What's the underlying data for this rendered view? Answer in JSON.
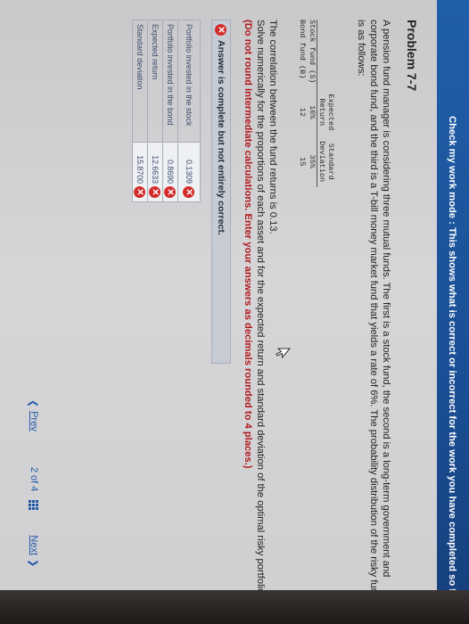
{
  "banner": {
    "text": "Check my work mode : This shows what is correct or incorrect for the work you have completed so far. It does"
  },
  "problem": {
    "title": "Problem 7-7",
    "intro": "A pension fund manager is considering three mutual funds. The first is a stock fund, the second is a long-term government and corporate bond fund, and the third is a T-bill money market fund that yields a rate of 6%. The probability distribution of the risky funds is as follows:",
    "table": {
      "headers": [
        "",
        "Expected Return",
        "Standard Deviation"
      ],
      "header_lines": [
        [
          "Expected",
          "Return"
        ],
        [
          "Standard",
          "Deviation"
        ]
      ],
      "rows": [
        {
          "label": "Stock fund (S)",
          "expected": "16%",
          "stdev": "35%"
        },
        {
          "label": "Bond fund (B)",
          "expected": "12",
          "stdev": "15"
        }
      ]
    },
    "correlation": "The correlation between the fund returns is 0.13.",
    "question": "Solve numerically for the proportions of each asset and for the expected return and standard deviation of the optimal risky portfolio.",
    "instruction": "(Do not round intermediate calculations. Enter your answers as decimals rounded to 4 places.)"
  },
  "answer": {
    "status": "Answer is complete but not entirely correct.",
    "rows": [
      {
        "label": "Portfolio invested in the stock",
        "value": "0.1309"
      },
      {
        "label": "Portfolio invested in the bond",
        "value": "0.8690"
      },
      {
        "label": "Expected return",
        "value": "12.6633"
      },
      {
        "label": "Standard deviation",
        "value": "15.8700"
      }
    ]
  },
  "pager": {
    "prev": "Prev",
    "current": "2",
    "of": "of",
    "total": "4",
    "next": "Next"
  },
  "colors": {
    "banner": "#1f5fa8",
    "incorrect": "#d42b2b",
    "instruction": "#b0191c",
    "link": "#1f57a8"
  },
  "icons": [
    "x-circle-icon",
    "chevron-left-icon",
    "chevron-right-icon",
    "grid-icon",
    "cursor-icon"
  ]
}
